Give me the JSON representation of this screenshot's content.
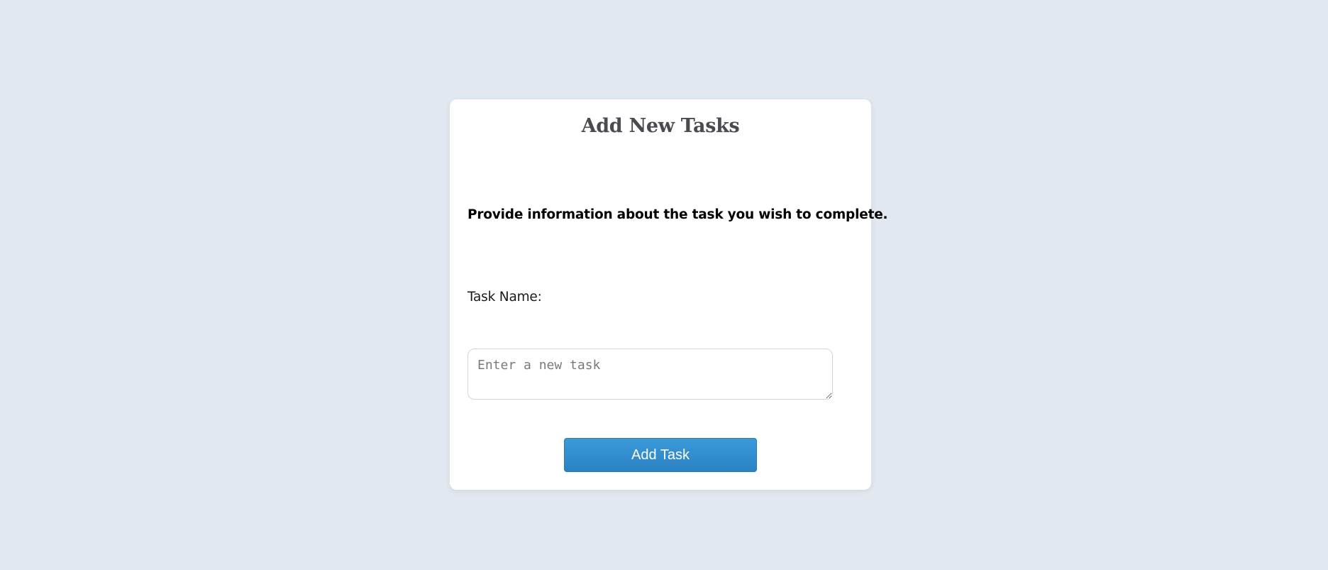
{
  "form": {
    "title": "Add New Tasks",
    "instruction": "Provide information about the task you wish to complete.",
    "task_name_label": "Task Name:",
    "task_input": {
      "value": "",
      "placeholder": "Enter a new task"
    },
    "submit_label": "Add Task"
  },
  "colors": {
    "page_background": "#e1e8f0",
    "card_background": "#ffffff",
    "button_accent": "#3498db",
    "title_text": "#4a4a50"
  }
}
